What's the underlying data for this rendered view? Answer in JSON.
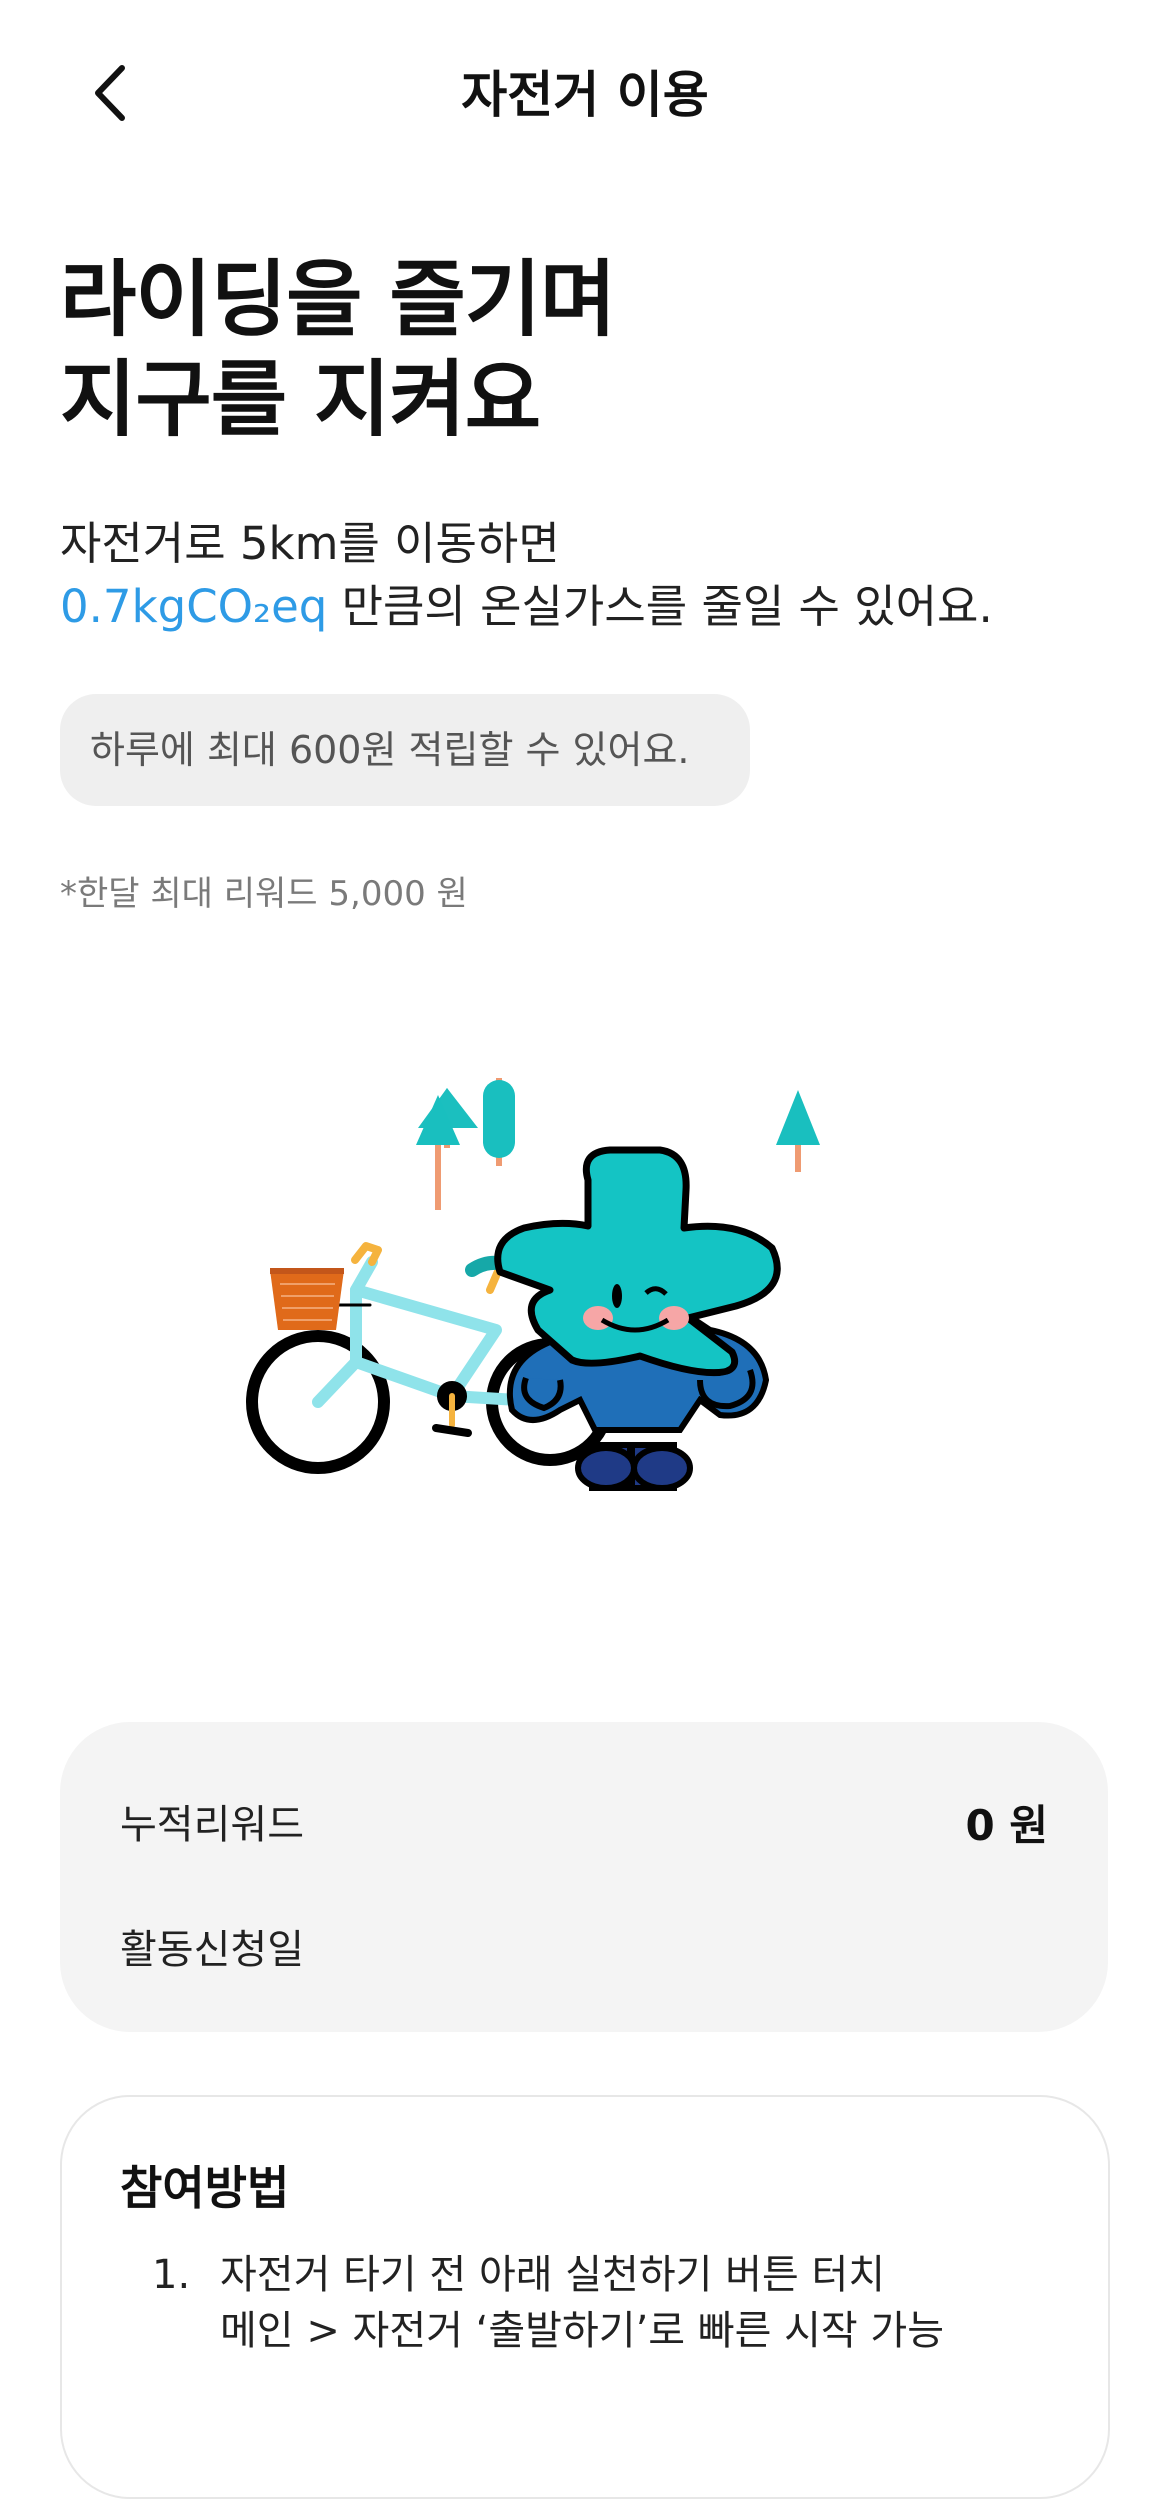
{
  "header": {
    "title": "자전거 이용",
    "back_icon": "chevron-left-icon"
  },
  "hero": {
    "headline_line1": "라이딩을 즐기며",
    "headline_line2": "지구를 지켜요"
  },
  "description": {
    "line1": "자전거로 5km를 이동하면",
    "highlight": "0.7kgCO₂eq",
    "line2_rest": " 만큼의 온실가스를 줄일 수 있어요."
  },
  "daily_limit_text": "하루에 최대 600원 적립할 수 있어요.",
  "footnote": "*한달 최대 리워드 5,000 원",
  "reward_card": {
    "accumulated_label": "누적리워드",
    "accumulated_value": "0 원",
    "applied_date_label": "활동신청일"
  },
  "method": {
    "title": "참여방법",
    "steps": [
      {
        "num": "1.",
        "line1": "자전거 타기 전 아래 실천하기 버튼 터치",
        "line2": "메인 > 자전거 ‘출발하기’로 빠른 시작 가능"
      }
    ]
  },
  "colors": {
    "accent": "#2e9be6",
    "mascot_teal": "#14c4c4",
    "mascot_blue": "#1f6fb8",
    "bike_frame": "#8fe3ea",
    "basket": "#e06a1a"
  }
}
